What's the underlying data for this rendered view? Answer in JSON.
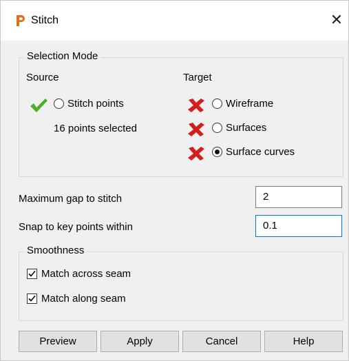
{
  "window": {
    "title": "Stitch",
    "app_icon": "powershape-p-icon",
    "close_glyph": "✕"
  },
  "selection_mode": {
    "group_title": "Selection Mode",
    "source": {
      "heading": "Source",
      "options": [
        {
          "label": "Stitch points",
          "status": "valid",
          "selected": false
        }
      ],
      "count_text": "16 points selected"
    },
    "target": {
      "heading": "Target",
      "options": [
        {
          "label": "Wireframe",
          "status": "invalid",
          "selected": false
        },
        {
          "label": "Surfaces",
          "status": "invalid",
          "selected": false
        },
        {
          "label": "Surface curves",
          "status": "invalid",
          "selected": true
        }
      ]
    }
  },
  "fields": {
    "max_gap": {
      "label": "Maximum gap to stitch",
      "value": "2"
    },
    "snap": {
      "label": "Snap to key points within",
      "value": "0.1"
    }
  },
  "smoothness": {
    "group_title": "Smoothness",
    "options": [
      {
        "label": "Match across seam",
        "checked": true
      },
      {
        "label": "Match along seam",
        "checked": true
      }
    ]
  },
  "buttons": {
    "preview": "Preview",
    "apply": "Apply",
    "cancel": "Cancel",
    "help": "Help"
  },
  "colors": {
    "valid_check": "#4caf28",
    "invalid_cross": "#d21e1e",
    "app_icon": "#e0701e",
    "focus_border": "#0078d7"
  }
}
